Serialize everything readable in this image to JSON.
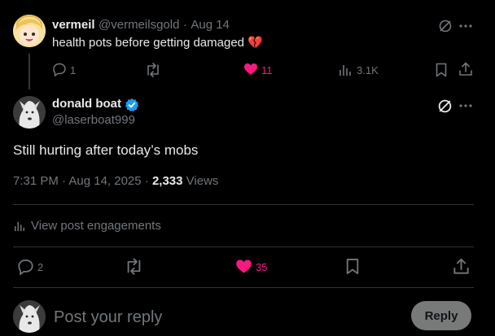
{
  "parent_post": {
    "display_name": "vermeil",
    "handle": "@vermeilsgold",
    "separator": "·",
    "date": "Aug 14",
    "text": "health pots before getting damaged",
    "emoji": "💔",
    "replies": "1",
    "likes": "11",
    "views": "3.1K"
  },
  "main_post": {
    "display_name": "donald boat",
    "handle": "@laserboat999",
    "text": "Still hurting after today’s mobs",
    "time": "7:31 PM · Aug 14, 2025 ·",
    "views_count": "2,333",
    "views_label": "Views",
    "engagements_label": "View post engagements",
    "replies": "2",
    "likes": "35"
  },
  "composer": {
    "placeholder": "Post your reply",
    "reply_label": "Reply"
  },
  "colors": {
    "accent_like": "#f91880",
    "verified": "#1d9bf0",
    "muted": "#71767b"
  },
  "icons": [
    "grok-icon",
    "more-icon",
    "reply-icon",
    "retweet-icon",
    "like-icon",
    "views-icon",
    "bookmark-icon",
    "share-icon",
    "verified-badge-icon"
  ]
}
